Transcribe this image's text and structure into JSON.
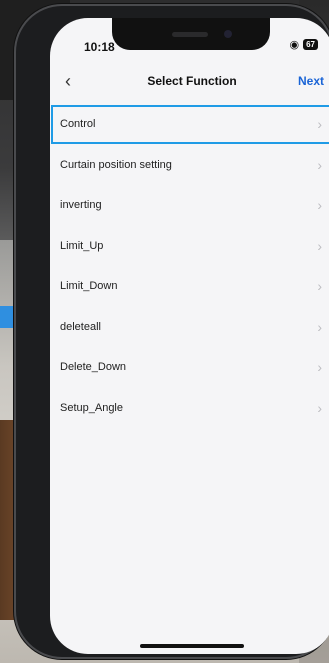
{
  "status": {
    "time": "10:18",
    "battery": "67"
  },
  "nav": {
    "back_icon": "chevron-left-icon",
    "title": "Select Function",
    "next_label": "Next"
  },
  "functions": [
    {
      "label": "Control",
      "selected": true
    },
    {
      "label": "Curtain position setting"
    },
    {
      "label": "inverting"
    },
    {
      "label": "Limit_Up"
    },
    {
      "label": "Limit_Down"
    },
    {
      "label": "deleteall"
    },
    {
      "label": "Delete_Down"
    },
    {
      "label": "Setup_Angle"
    }
  ],
  "colors": {
    "accent": "#1a64d6",
    "selection_border": "#1f9be6",
    "background": "#f5f5f7"
  }
}
